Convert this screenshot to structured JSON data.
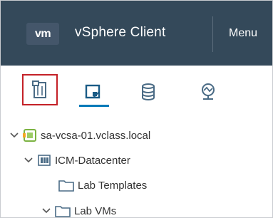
{
  "header": {
    "logo": "vm",
    "title": "vSphere Client",
    "menu_label": "Menu"
  },
  "tabs": [
    {
      "icon": "hosts-and-clusters-icon",
      "selected": true
    },
    {
      "icon": "vms-and-templates-icon",
      "selected": false
    },
    {
      "icon": "storage-icon",
      "selected": false
    },
    {
      "icon": "networking-icon",
      "selected": false
    }
  ],
  "tree": [
    {
      "label": "sa-vcsa-01.vclass.local",
      "icon": "vcenter-icon",
      "expanded": true
    },
    {
      "label": "ICM-Datacenter",
      "icon": "datacenter-icon",
      "expanded": true
    },
    {
      "label": "Lab Templates",
      "icon": "folder-icon"
    },
    {
      "label": "Lab VMs",
      "icon": "folder-icon",
      "expanded": true
    }
  ],
  "colors": {
    "header_bg": "#34495a",
    "selection_outline": "#c42127",
    "accent": "#0079b8"
  }
}
